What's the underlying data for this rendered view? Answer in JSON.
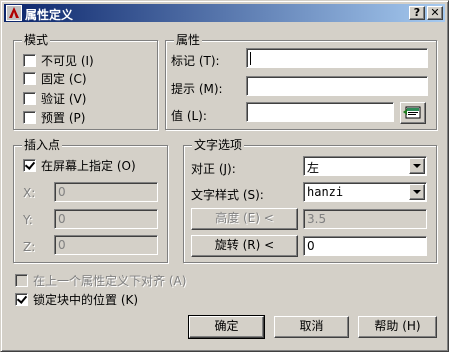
{
  "window": {
    "title": "属性定义"
  },
  "titlebar": {
    "help_label": "?",
    "close_label": "✕"
  },
  "mode": {
    "label": "模式",
    "options": [
      {
        "label": "不可见 (I)",
        "checked": false
      },
      {
        "label": "固定 (C)",
        "checked": false
      },
      {
        "label": "验证 (V)",
        "checked": false
      },
      {
        "label": "预置 (P)",
        "checked": false
      }
    ]
  },
  "attribute": {
    "label": "属性",
    "tag_label": "标记 (T):",
    "tag_value": "",
    "prompt_label": "提示 (M):",
    "prompt_value": "",
    "value_label": "值 (L):",
    "value_value": ""
  },
  "insertion_point": {
    "label": "插入点",
    "specify_on_screen_label": "在屏幕上指定 (O)",
    "specify_on_screen_checked": true,
    "x_label": "X:",
    "x_value": "0",
    "y_label": "Y:",
    "y_value": "0",
    "z_label": "Z:",
    "z_value": "0"
  },
  "text_options": {
    "label": "文字选项",
    "justify_label": "对正 (J):",
    "justify_value": "左",
    "style_label": "文字样式 (S):",
    "style_value": "hanzi",
    "height_button": "高度 (E) <",
    "height_value": "3.5",
    "rotation_button": "旋转 (R) <",
    "rotation_value": "0"
  },
  "align_below_label": "在上一个属性定义下对齐 (A)",
  "align_below_checked": false,
  "lock_position_label": "锁定块中的位置 (K)",
  "lock_position_checked": true,
  "buttons": {
    "ok": "确定",
    "cancel": "取消",
    "help": "帮助 (H)"
  }
}
